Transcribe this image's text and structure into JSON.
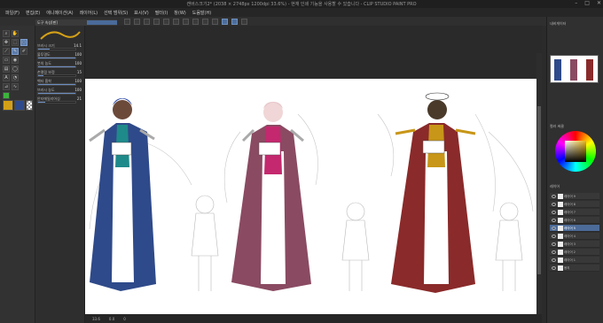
{
  "window": {
    "title": "캔버스크기2* (2038 × 2748px 1200dpi 33.6%) - 현재 인쇄 기능을 사용할 수 있습니다 - CLIP STUDIO PAINT PRO",
    "controls": [
      "–",
      "□",
      "✕"
    ]
  },
  "menubar": {
    "items": [
      "파일(F)",
      "편집(E)",
      "애니메이션(A)",
      "레이어(L)",
      "선택 범위(S)",
      "표시(V)",
      "필터(I)",
      "창(W)",
      "도움말(H)"
    ]
  },
  "tool_property": {
    "tab_label": "도구 속성[펜]",
    "rows": [
      {
        "label": "브러시 크기",
        "value": "14.1",
        "fill": 0.3
      },
      {
        "label": "불투명도",
        "value": "100",
        "fill": 1.0
      },
      {
        "label": "붓의 농도",
        "value": "100",
        "fill": 1.0
      },
      {
        "label": "손떨림 보정",
        "value": "15",
        "fill": 0.15
      },
      {
        "label": "벡터 흡착",
        "value": "100",
        "fill": 1.0
      },
      {
        "label": "브러시 농도",
        "value": "100",
        "fill": 1.0
      },
      {
        "label": "안티에일리어싱",
        "value": "21",
        "fill": 0.2
      }
    ]
  },
  "colors": {
    "main": "#d4a017",
    "sub": "#2d4a8c",
    "accent_select": "#4c6b98",
    "char1": "#2f4a8a",
    "char2": "#8a4a62",
    "char3": "#8a2a2a"
  },
  "right_panel": {
    "navigator_label": "내비게이터",
    "color_label": "컬러 써클",
    "layer_label": "레이어",
    "layers": [
      {
        "name": "레이어 9",
        "selected": false
      },
      {
        "name": "레이어 8",
        "selected": false
      },
      {
        "name": "레이어 7",
        "selected": false
      },
      {
        "name": "레이어 6",
        "selected": false
      },
      {
        "name": "레이어 5",
        "selected": true
      },
      {
        "name": "레이어 4",
        "selected": false
      },
      {
        "name": "레이어 3",
        "selected": false
      },
      {
        "name": "레이어 2",
        "selected": false
      },
      {
        "name": "레이어 1",
        "selected": false
      },
      {
        "name": "용지",
        "selected": false
      }
    ]
  },
  "status": {
    "zoom": "33.6",
    "angle": "0.0",
    "position": "0"
  },
  "icons": {
    "tools": [
      "zoom-icon",
      "hand-icon",
      "move-icon",
      "select-icon",
      "lasso-icon",
      "eyedropper-icon",
      "pen-icon",
      "brush-icon",
      "eraser-icon",
      "fill-icon",
      "gradient-icon",
      "figure-icon",
      "text-icon",
      "balloon-icon",
      "ruler-icon",
      "blend-icon"
    ]
  }
}
